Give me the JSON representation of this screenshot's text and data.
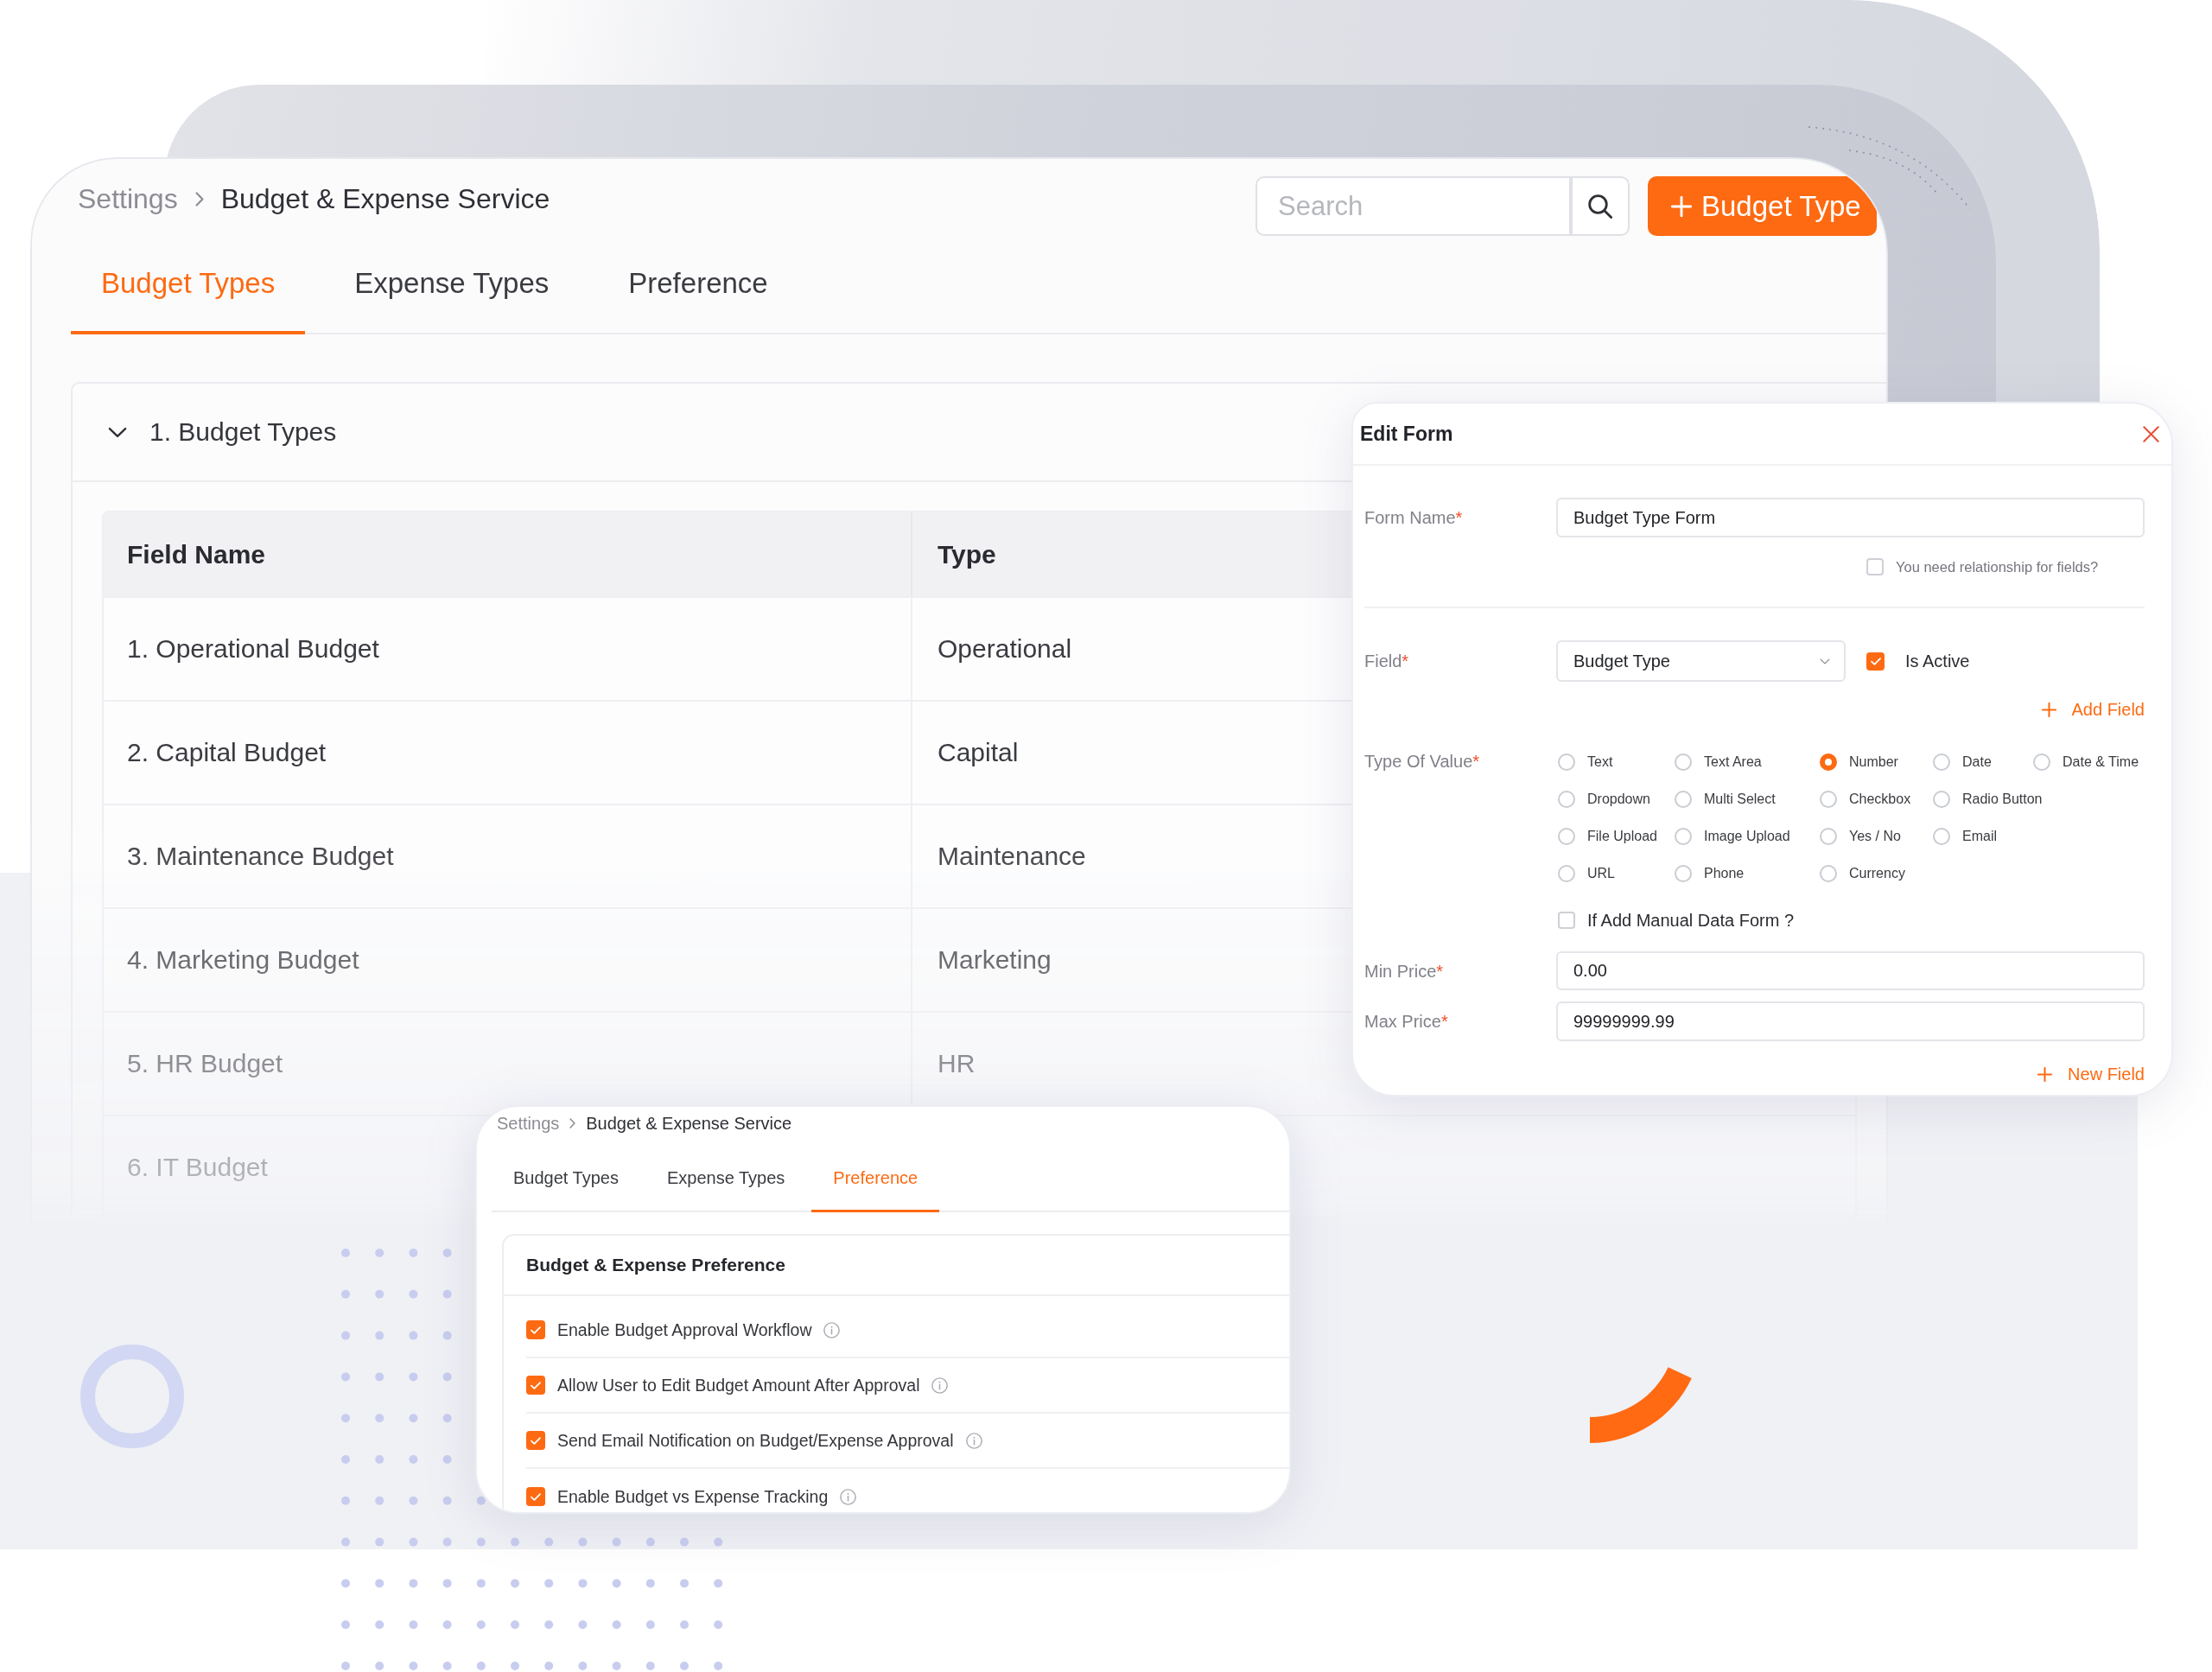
{
  "main_window": {
    "breadcrumb": [
      "Settings",
      "Budget & Expense Service"
    ],
    "search": {
      "placeholder": "Search"
    },
    "add_button": {
      "label": "Budget Type"
    },
    "tabs": [
      {
        "label": "Budget Types",
        "selected": true
      },
      {
        "label": "Expense Types",
        "selected": false
      },
      {
        "label": "Preference",
        "selected": false
      }
    ],
    "section": {
      "title": "1. Budget Types",
      "expanded": true,
      "table": {
        "columns": [
          "Field Name",
          "Type"
        ],
        "rows": [
          {
            "field_name": "1. Operational Budget",
            "type": "Operational"
          },
          {
            "field_name": "2. Capital Budget",
            "type": "Capital"
          },
          {
            "field_name": "3. Maintenance Budget",
            "type": "Maintenance"
          },
          {
            "field_name": "4. Marketing Budget",
            "type": "Marketing"
          },
          {
            "field_name": "5. HR Budget",
            "type": "HR"
          },
          {
            "field_name": "6. IT Budget"
          }
        ]
      }
    }
  },
  "edit_form": {
    "title": "Edit Form",
    "form_name": {
      "label": "Form Name",
      "required_mark": "*",
      "value": "Budget Type Form"
    },
    "relationship": {
      "label": "You need relationship for fields?",
      "checked": false
    },
    "field": {
      "label": "Field",
      "required_mark": "*",
      "value": "Budget Type"
    },
    "is_active": {
      "label": "Is Active",
      "checked": true
    },
    "add_field": {
      "label": "Add Field"
    },
    "type_of_value": {
      "label": "Type Of Value",
      "required_mark": "*",
      "rows": [
        [
          {
            "label": "Text",
            "selected": false
          },
          {
            "label": "Text Area",
            "selected": false
          },
          {
            "label": "Number",
            "selected": true
          },
          {
            "label": "Date",
            "selected": false
          },
          {
            "label": "Date & Time",
            "selected": false
          }
        ],
        [
          {
            "label": "Dropdown",
            "selected": false
          },
          {
            "label": "Multi Select",
            "selected": false
          },
          {
            "label": "Checkbox",
            "selected": false
          },
          {
            "label": "Radio Button",
            "selected": false
          }
        ],
        [
          {
            "label": "File Upload",
            "selected": false
          },
          {
            "label": "Image Upload",
            "selected": false
          },
          {
            "label": "Yes / No",
            "selected": false
          },
          {
            "label": "Email",
            "selected": false
          }
        ],
        [
          {
            "label": "URL",
            "selected": false
          },
          {
            "label": "Phone",
            "selected": false
          },
          {
            "label": "Currency",
            "selected": false
          }
        ]
      ]
    },
    "manual_data_form": {
      "label": "If Add Manual Data Form ?",
      "checked": false
    },
    "min_price": {
      "label": "Min Price",
      "required_mark": "*",
      "value": "0.00"
    },
    "max_price": {
      "label": "Max Price",
      "required_mark": "*",
      "value": "99999999.99"
    },
    "new_field": {
      "label": "New Field"
    }
  },
  "preference_window": {
    "breadcrumb": [
      "Settings",
      "Budget & Expense Service"
    ],
    "tabs": [
      {
        "label": "Budget Types",
        "selected": false
      },
      {
        "label": "Expense Types",
        "selected": false
      },
      {
        "label": "Preference",
        "selected": true
      }
    ],
    "card_title": "Budget & Expense Preference",
    "options": [
      {
        "label": "Enable Budget Approval Workflow",
        "checked": true
      },
      {
        "label": "Allow User to Edit Budget Amount After Approval",
        "checked": true
      },
      {
        "label": "Send Email Notification on Budget/Expense Approval",
        "checked": true
      },
      {
        "label": "Enable Budget vs Expense Tracking",
        "checked": true
      }
    ]
  }
}
